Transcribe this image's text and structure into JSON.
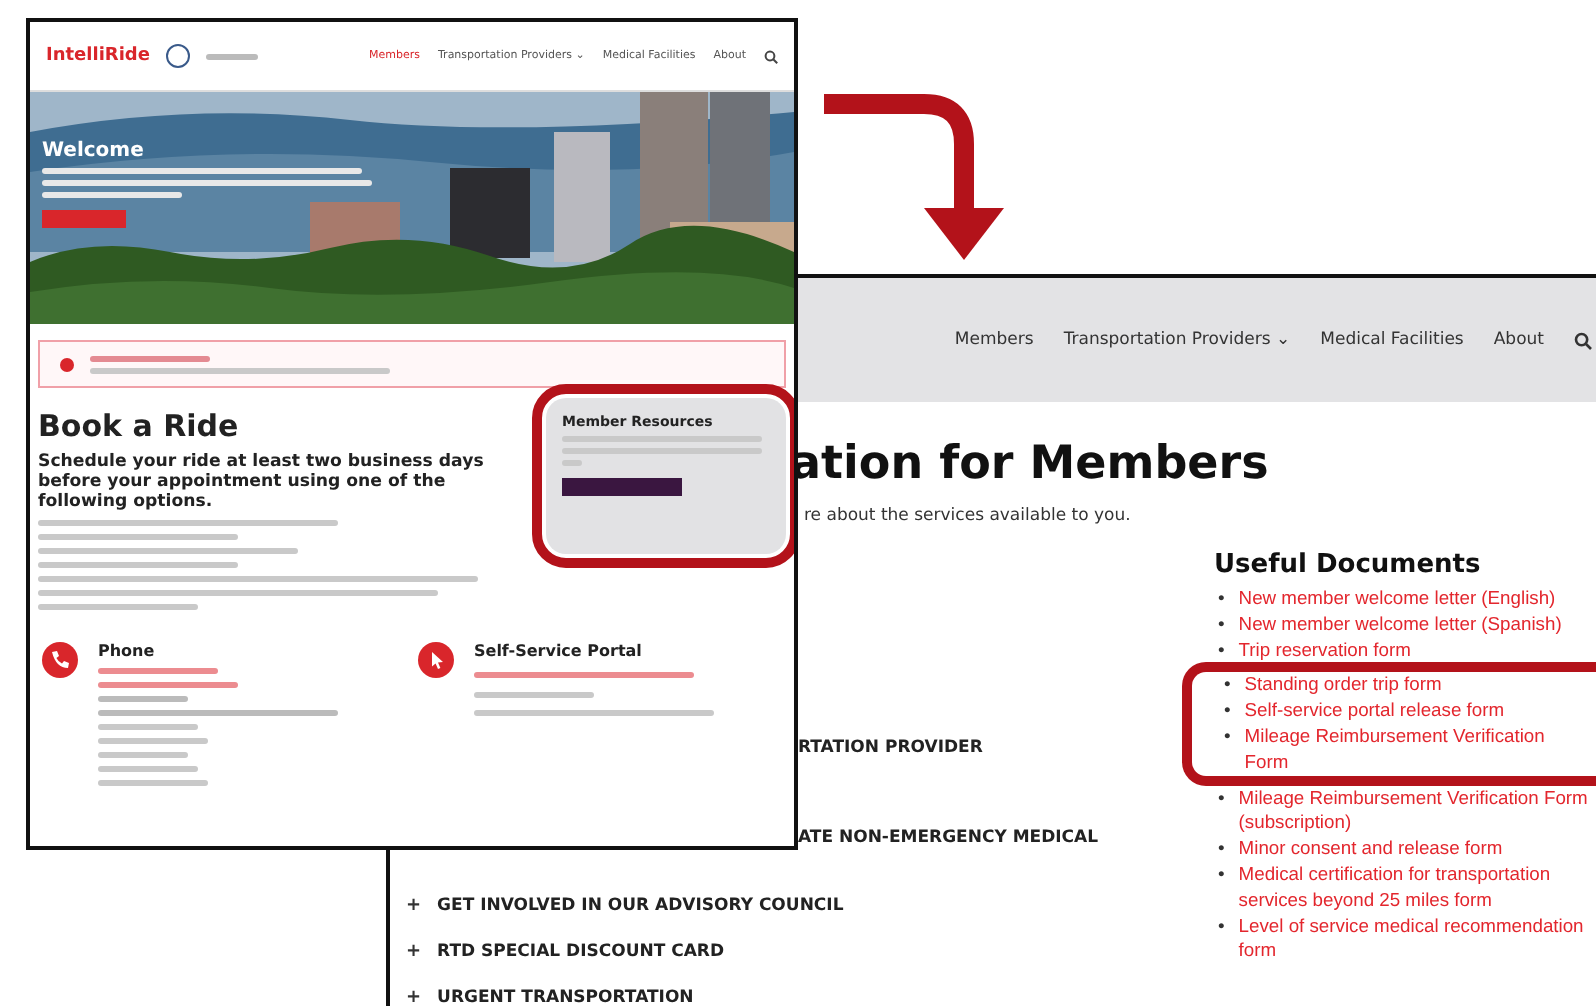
{
  "homepage_screenshot": {
    "logo": "IntelliRide",
    "nav": [
      {
        "label": "Members",
        "selected": true
      },
      {
        "label": "Transportation Providers ⌄",
        "selected": false
      },
      {
        "label": "Medical Facilities",
        "selected": false
      },
      {
        "label": "About",
        "selected": false
      }
    ],
    "hero": {
      "title": "Welcome",
      "kind": "picture"
    },
    "book_a_ride": {
      "title": "Book a Ride",
      "subtitle": "Schedule your ride at least two business days before your appointment using one of the following options."
    },
    "member_resources": {
      "title": "Member Resources",
      "highlighted": true
    },
    "options": [
      {
        "title": "Phone"
      },
      {
        "title": "Self-Service Portal"
      }
    ]
  },
  "members_page": {
    "nav": [
      {
        "label": "Members",
        "selected": false
      },
      {
        "label": "Transportation Providers ⌄",
        "selected": false
      },
      {
        "label": "Medical Facilities",
        "selected": false
      },
      {
        "label": "About",
        "selected": false
      }
    ],
    "title": "ation for Members",
    "intro": "re about the services available to you.",
    "accordion": [
      {
        "label": "RTATION PROVIDER",
        "partly_hidden": true
      },
      {
        "label": "ATE NON-EMERGENCY MEDICAL",
        "partly_hidden": true
      },
      {
        "marker": "+",
        "label": "GET INVOLVED IN OUR ADVISORY COUNCIL",
        "partly_hidden": false
      },
      {
        "marker": "+",
        "label": "RTD SPECIAL DISCOUNT CARD",
        "partly_hidden": false
      },
      {
        "marker": "+",
        "label": "URGENT TRANSPORTATION",
        "partly_hidden": false
      }
    ],
    "useful_documents": {
      "title": "Useful Documents",
      "items": [
        {
          "bullet": "•",
          "label": "New member welcome letter (English)",
          "highlighted": false
        },
        {
          "bullet": "•",
          "label": "New member welcome letter (Spanish)",
          "highlighted": false
        },
        {
          "bullet": "•",
          "label": "Trip reservation form",
          "highlighted": false
        },
        {
          "bullet": "•",
          "label": "Standing order trip form",
          "highlighted": true
        },
        {
          "bullet": "•",
          "label": "Self-service portal release form",
          "highlighted": true
        },
        {
          "bullet": "•",
          "label": "Mileage Reimbursement Verification Form",
          "highlighted": true
        },
        {
          "bullet": "•",
          "label": "Mileage Reimbursement Verification Form (subscription)",
          "highlighted": false
        },
        {
          "bullet": "•",
          "label": "Minor consent and release form",
          "highlighted": false
        },
        {
          "bullet": "•",
          "label": "Medical certification for transportation services beyond 25 miles form",
          "highlighted": false
        },
        {
          "bullet": "•",
          "label": "Level of service medical recommendation form",
          "highlighted": false
        }
      ]
    }
  }
}
